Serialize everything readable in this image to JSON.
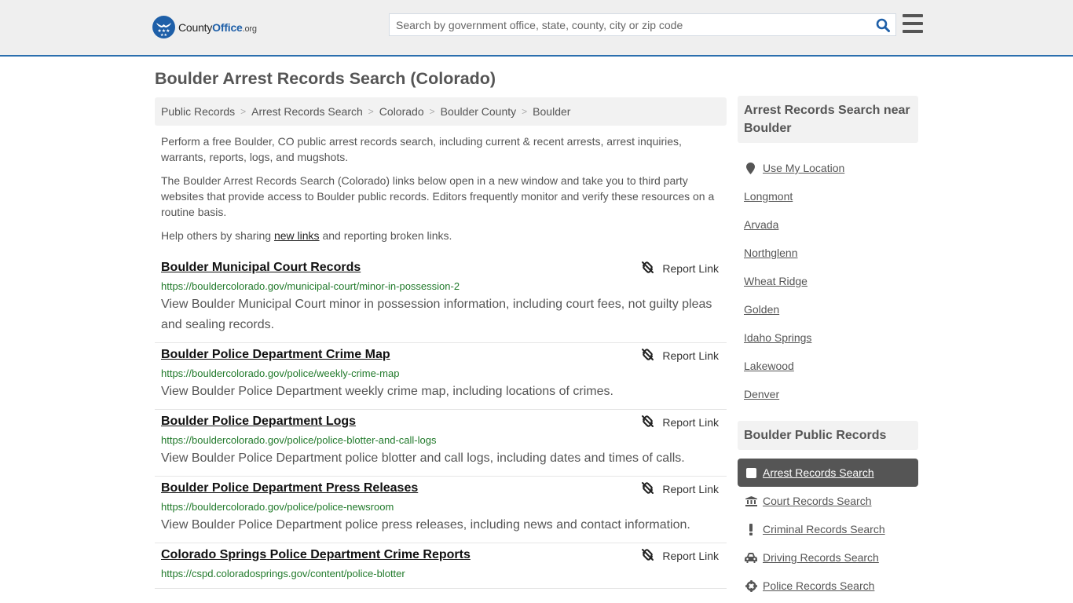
{
  "header": {
    "logo": {
      "county": "County",
      "office": "Office",
      "org": ".org"
    },
    "search": {
      "placeholder": "Search by government office, state, county, city or zip code",
      "value": ""
    },
    "icons": {
      "search": "search-icon",
      "menu": "hamburger-menu-icon"
    }
  },
  "page": {
    "title": "Boulder Arrest Records Search (Colorado)"
  },
  "breadcrumb": [
    "Public Records",
    "Arrest Records Search",
    "Colorado",
    "Boulder County",
    "Boulder"
  ],
  "intro": {
    "p1": "Perform a free Boulder, CO public arrest records search, including current & recent arrests, arrest inquiries, warrants, reports, logs, and mugshots.",
    "p2": "The Boulder Arrest Records Search (Colorado) links below open in a new window and take you to third party websites that provide access to Boulder public records. Editors frequently monitor and verify these resources on a routine basis.",
    "p3_before": "Help others by sharing ",
    "p3_link": "new links",
    "p3_after": " and reporting broken links."
  },
  "results": [
    {
      "title": "Boulder Municipal Court Records",
      "url": "https://bouldercolorado.gov/municipal-court/minor-in-possession-2",
      "description": "View Boulder Municipal Court minor in possession information, including court fees, not guilty pleas and sealing records.",
      "report_label": "Report Link"
    },
    {
      "title": "Boulder Police Department Crime Map",
      "url": "https://bouldercolorado.gov/police/weekly-crime-map",
      "description": "View Boulder Police Department weekly crime map, including locations of crimes.",
      "report_label": "Report Link"
    },
    {
      "title": "Boulder Police Department Logs",
      "url": "https://bouldercolorado.gov/police/police-blotter-and-call-logs",
      "description": "View Boulder Police Department police blotter and call logs, including dates and times of calls.",
      "report_label": "Report Link"
    },
    {
      "title": "Boulder Police Department Press Releases",
      "url": "https://bouldercolorado.gov/police/police-newsroom",
      "description": "View Boulder Police Department police press releases, including news and contact information.",
      "report_label": "Report Link"
    },
    {
      "title": "Colorado Springs Police Department Crime Reports",
      "url": "https://cspd.coloradosprings.gov/content/police-blotter",
      "description": "",
      "report_label": "Report Link"
    }
  ],
  "sidebar": {
    "near": {
      "heading": "Arrest Records Search near Boulder",
      "use_location": "Use My Location",
      "cities": [
        "Longmont",
        "Arvada",
        "Northglenn",
        "Wheat Ridge",
        "Golden",
        "Idaho Springs",
        "Lakewood",
        "Denver"
      ]
    },
    "public_records": {
      "heading": "Boulder Public Records",
      "items": [
        {
          "label": "Arrest Records Search",
          "icon": "square-icon",
          "active": true
        },
        {
          "label": "Court Records Search",
          "icon": "courthouse-icon",
          "active": false
        },
        {
          "label": "Criminal Records Search",
          "icon": "exclamation-icon",
          "active": false
        },
        {
          "label": "Driving Records Search",
          "icon": "car-icon",
          "active": false
        },
        {
          "label": "Police Records Search",
          "icon": "crosshair-icon",
          "active": false
        }
      ]
    }
  },
  "colors": {
    "brand_blue": "#1e5fa8",
    "url_green": "#217a2b",
    "active_item_bg": "#555555"
  }
}
